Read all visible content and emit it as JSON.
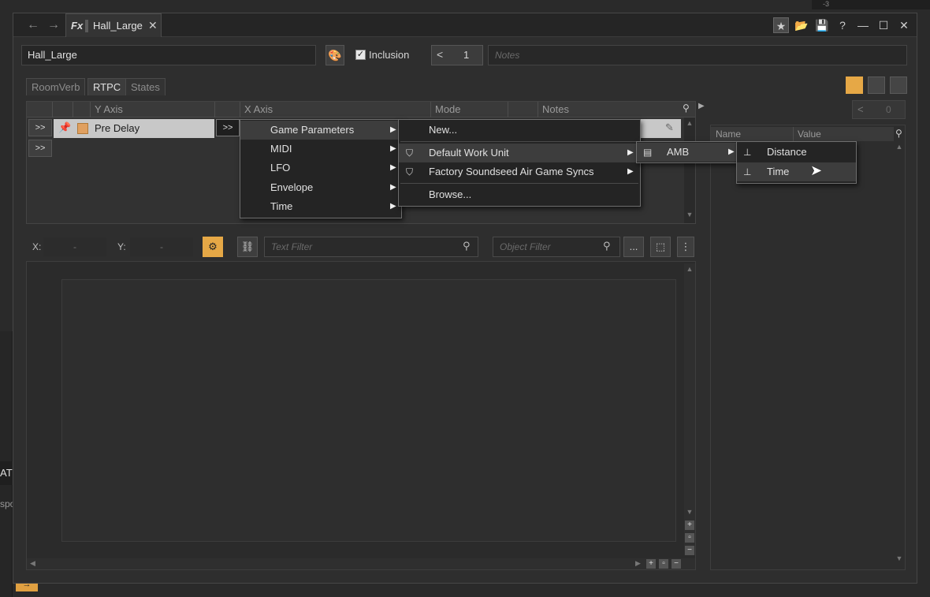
{
  "background": {
    "left_tag": "AT",
    "left_tag2": "spo",
    "topright_value": "-3",
    "bottom_orange": "→"
  },
  "titlebar": {
    "tab_icon": "Fx",
    "tab_title": "Hall_Large",
    "close": "✕",
    "back": "←",
    "forward": "→",
    "icons": [
      "★",
      "📂",
      "💾",
      "?",
      "—",
      "☐",
      "✕"
    ]
  },
  "name_row": {
    "name_value": "Hall_Large",
    "inclusion_label": "Inclusion",
    "inclusion_checked": "✓",
    "share_count": "1",
    "notes_placeholder": "Notes"
  },
  "subtabs": [
    {
      "label": "RoomVerb"
    },
    {
      "label": "RTPC"
    },
    {
      "label": "States"
    }
  ],
  "rtpc_table": {
    "headers": {
      "y_axis": "Y Axis",
      "x_axis": "X Axis",
      "mode": "Mode",
      "notes": "Notes"
    },
    "row_button": ">>",
    "row_label": "Pre Delay"
  },
  "filter_row": {
    "x_label": "X:",
    "x_value": "-",
    "y_label": "Y:",
    "y_value": "-",
    "text_filter_placeholder": "Text Filter",
    "object_filter_placeholder": "Object Filter",
    "more_label": "...",
    "kebab_label": "⋮"
  },
  "right_panel": {
    "share_count": "0",
    "headers": {
      "name": "Name",
      "value": "Value"
    }
  },
  "menus": {
    "level1": [
      {
        "label": "Game Parameters"
      },
      {
        "label": "MIDI"
      },
      {
        "label": "LFO"
      },
      {
        "label": "Envelope"
      },
      {
        "label": "Time"
      }
    ],
    "level2": {
      "new": "New...",
      "work_units": [
        {
          "label": "Default Work Unit"
        },
        {
          "label": "Factory Soundseed Air Game Syncs"
        }
      ],
      "browse": "Browse..."
    },
    "level3": [
      {
        "label": "AMB"
      }
    ],
    "level4": [
      {
        "label": "Distance"
      },
      {
        "label": "Time"
      }
    ]
  },
  "icons": {
    "search": "search-icon",
    "pin": "pin-icon",
    "edit": "pencil-icon",
    "share": "share-icon",
    "folder": "folder-icon",
    "work_unit": "work-unit-icon",
    "game_parameter": "game-parameter-icon"
  },
  "colors": {
    "accent": "#e6a846",
    "selected_row": "#c8c8c8",
    "menu_bg": "#242424"
  }
}
